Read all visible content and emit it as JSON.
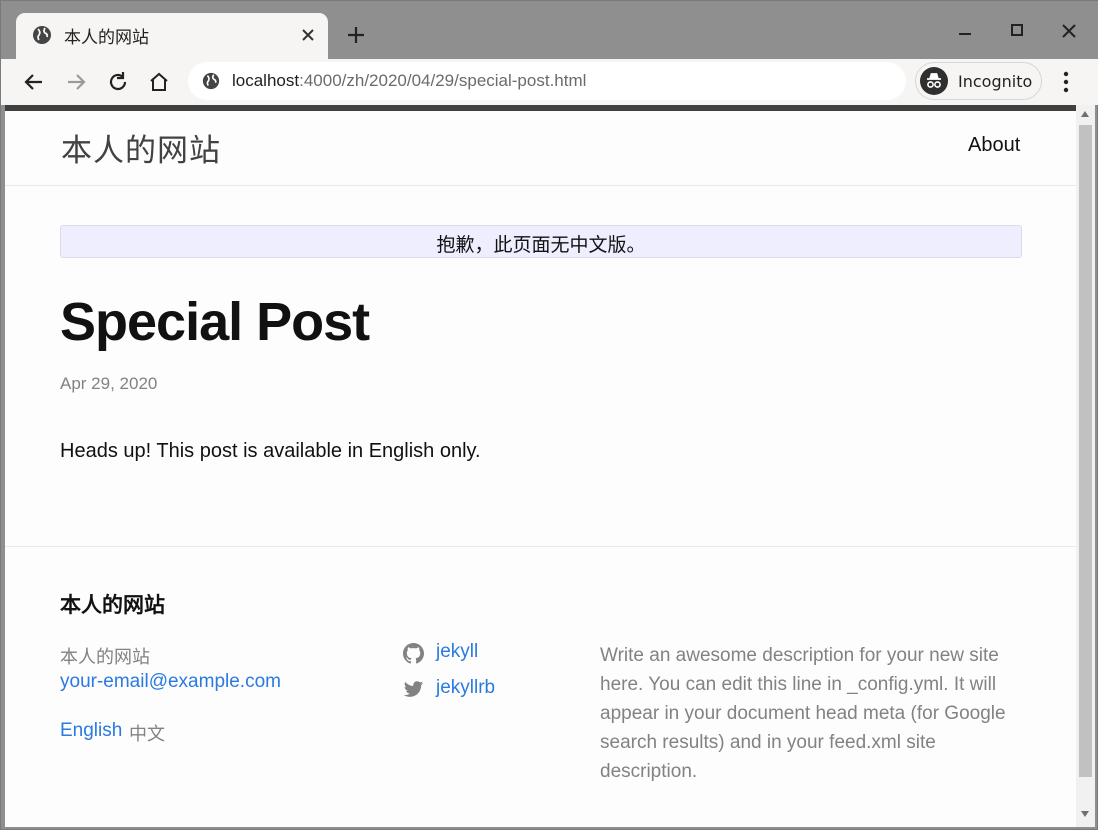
{
  "browser": {
    "tab_title": "本人的网站",
    "url_host": "localhost",
    "url_path": ":4000/zh/2020/04/29/special-post.html",
    "incognito_label": "Incognito",
    "icons": {
      "favicon": "globe-icon",
      "close": "close-icon",
      "new_tab": "plus-icon",
      "back": "arrow-left-icon",
      "forward": "arrow-right-icon",
      "reload": "reload-icon",
      "home": "home-icon",
      "site_info": "globe-icon",
      "menu": "kebab-menu-icon"
    }
  },
  "header": {
    "site_title": "本人的网站",
    "nav_about": "About"
  },
  "notice": {
    "text": "抱歉，此页面无中文版。"
  },
  "post": {
    "title": "Special Post",
    "date": "Apr 29, 2020",
    "body": "Heads up! This post is available in English only."
  },
  "footer": {
    "heading": "本人的网站",
    "name": "本人的网站",
    "email": "your-email@example.com",
    "lang_english": "English",
    "lang_chinese": "中文",
    "social": [
      {
        "icon": "github-icon",
        "label": "jekyll"
      },
      {
        "icon": "twitter-icon",
        "label": "jekyllrb"
      }
    ],
    "description": "Write an awesome description for your new site here. You can edit this line in _config.yml. It will appear in your document head meta (for Google search results) and in your feed.xml site description."
  },
  "colors": {
    "link": "#2a7ae2",
    "muted": "#828282",
    "notice_bg": "#eeeeff",
    "chrome_frame": "#8f8f8f",
    "chrome_toolbar": "#f6f5f3"
  }
}
